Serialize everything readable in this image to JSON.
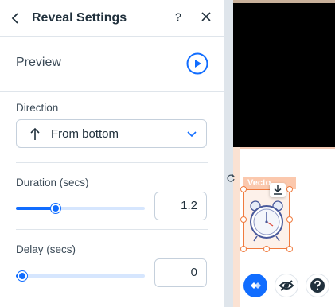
{
  "panel": {
    "title": "Reveal Settings",
    "help_label": "?",
    "preview": {
      "label": "Preview"
    },
    "direction": {
      "label": "Direction",
      "value": "From bottom"
    },
    "duration": {
      "label": "Duration (secs)",
      "value": "1.2",
      "slider_fraction": 0.31
    },
    "delay": {
      "label": "Delay (secs)",
      "value": "0",
      "slider_fraction": 0.05
    }
  },
  "canvas": {
    "element_tag": "Vecto"
  },
  "colors": {
    "accent": "#116dff",
    "selection": "#f07b3f",
    "text": "#20303c"
  },
  "icons": [
    "chevron-left-icon",
    "question-icon",
    "close-icon",
    "play-icon",
    "arrow-up-icon",
    "chevron-down-icon",
    "rotate-icon",
    "download-icon",
    "alarm-clock-icon",
    "wix-diamond-icon",
    "hide-eye-icon",
    "help-circle-icon"
  ]
}
